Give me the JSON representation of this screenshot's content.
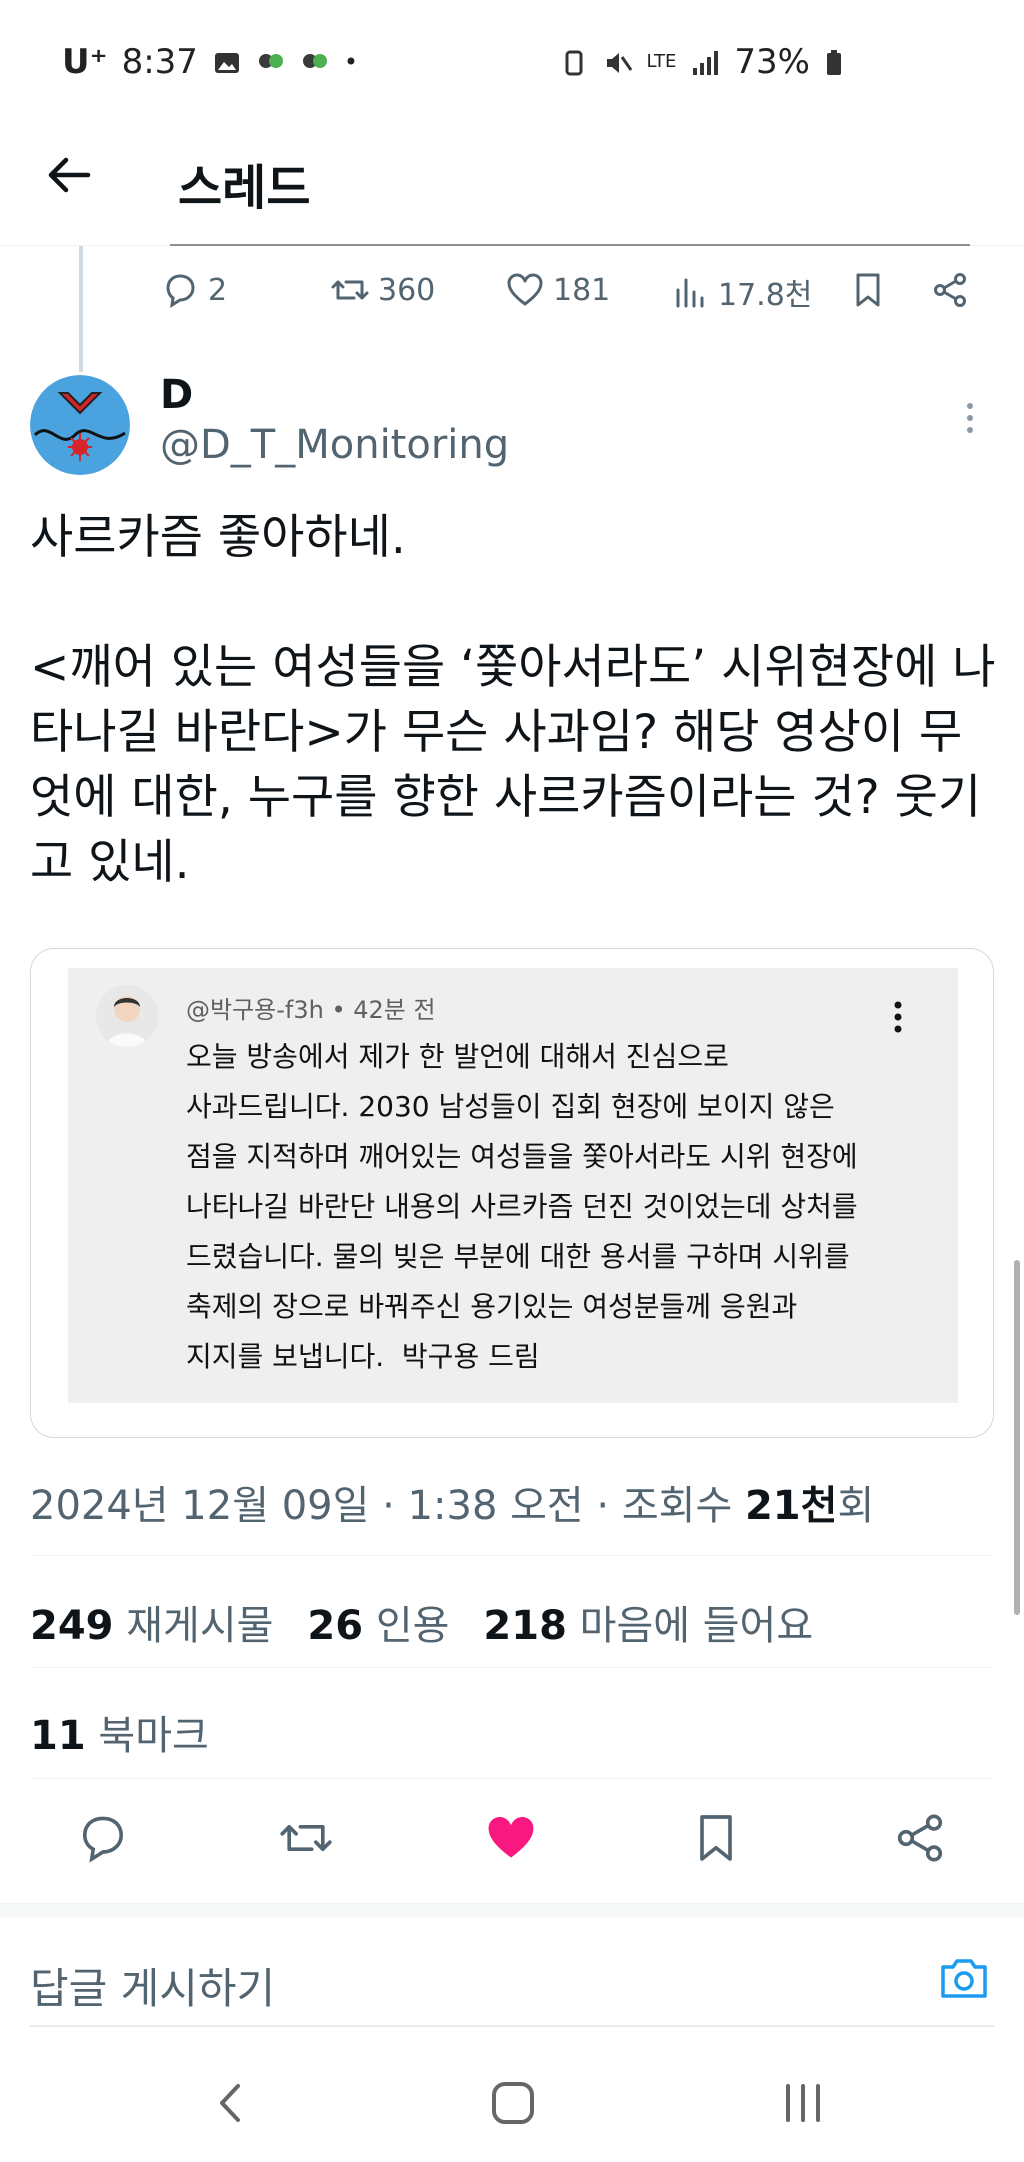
{
  "status_bar": {
    "carrier": "U⁺",
    "time": "8:37",
    "network": "LTE",
    "battery": "73%"
  },
  "header": {
    "title": "스레드"
  },
  "prev_tweet_actions": {
    "replies": "2",
    "retweets": "360",
    "likes": "181",
    "views": "17.8천"
  },
  "tweet": {
    "author_name": "D",
    "author_handle": "@D_T_Monitoring",
    "text": "사르카즘 좋아하네.\n\n<깨어 있는 여성들을 ‘쫓아서라도’ 시위현장에 나타나길 바란다>가 무슨 사과임? 해당 영상이 무엇에 대한, 누구를 향한 사르카즘이라는 것? 웃기고 있네.",
    "embedded_comment": {
      "meta": "@박구용-f3h • 42분 전",
      "text": "오늘 방송에서 제가 한 발언에 대해서 진심으로\n사과드립니다. 2030 남성들이 집회 현장에 보이지 않은\n점을 지적하며 깨어있는 여성들을 쫓아서라도 시위 현장에\n나타나길 바란단 내용의 사르카즘 던진 것이었는데 상처를\n드렸습니다. 물의 빚은 부분에 대한 용서를 구하며 시위를\n축제의 장으로 바꿔주신 용기있는 여성분들께 응원과\n지지를 보냅니다.  박구용 드림"
    },
    "timestamp_prefix": "2024년 12월 09일 · 1:38 오전 · 조회수 ",
    "views_bold": "21천",
    "views_suffix": "회",
    "retweets_count": "249",
    "retweets_label": "재게시물",
    "quotes_count": "26",
    "quotes_label": "인용",
    "likes_count": "218",
    "likes_label": "마음에 들어요",
    "bookmarks_count": "11",
    "bookmarks_label": "북마크"
  },
  "reply": {
    "placeholder": "답글 게시하기"
  },
  "colors": {
    "like_active": "#f91880",
    "secondary_text": "#536471",
    "camera_accent": "#1d9bf0"
  }
}
